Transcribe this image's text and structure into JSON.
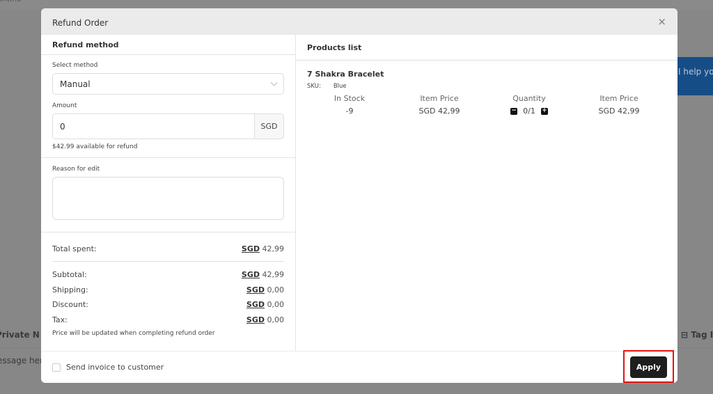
{
  "background": {
    "top_text": "ontino",
    "chat_banner": "I help you",
    "private_notes_tab": "Private N",
    "message_placeholder": "essage here",
    "tag_tab": "Tag I"
  },
  "modal": {
    "title": "Refund Order",
    "close_icon": "×",
    "left": {
      "section_title": "Refund method",
      "select_method_label": "Select method",
      "select_method_value": "Manual",
      "amount_label": "Amount",
      "amount_value": "0",
      "amount_currency": "SGD",
      "available_text": "$42.99 available for refund",
      "reason_label": "Reason for edit",
      "reason_value": "",
      "totals": {
        "total_spent": {
          "label": "Total spent:",
          "currency": "SGD",
          "amount": "42,99"
        },
        "rows": [
          {
            "label": "Subtotal:",
            "currency": "SGD",
            "amount": "42,99"
          },
          {
            "label": "Shipping:",
            "currency": "SGD",
            "amount": "0,00"
          },
          {
            "label": "Discount:",
            "currency": "SGD",
            "amount": "0,00"
          },
          {
            "label": "Tax:",
            "currency": "SGD",
            "amount": "0,00"
          }
        ],
        "note": "Price will be updated when completing refund order"
      }
    },
    "right": {
      "section_title": "Products list",
      "products": [
        {
          "name": "7 Shakra Bracelet",
          "sku_label": "SKU:",
          "sku_value": "Blue",
          "headers": [
            "In Stock",
            "Item Price",
            "Quantity",
            "Item Price"
          ],
          "in_stock": "-9",
          "item_price": "SGD 42,99",
          "quantity": "0/1",
          "total_price": "SGD 42,99"
        }
      ]
    },
    "footer": {
      "send_invoice_label": "Send invoice to customer",
      "send_invoice_checked": false,
      "apply_label": "Apply"
    }
  }
}
